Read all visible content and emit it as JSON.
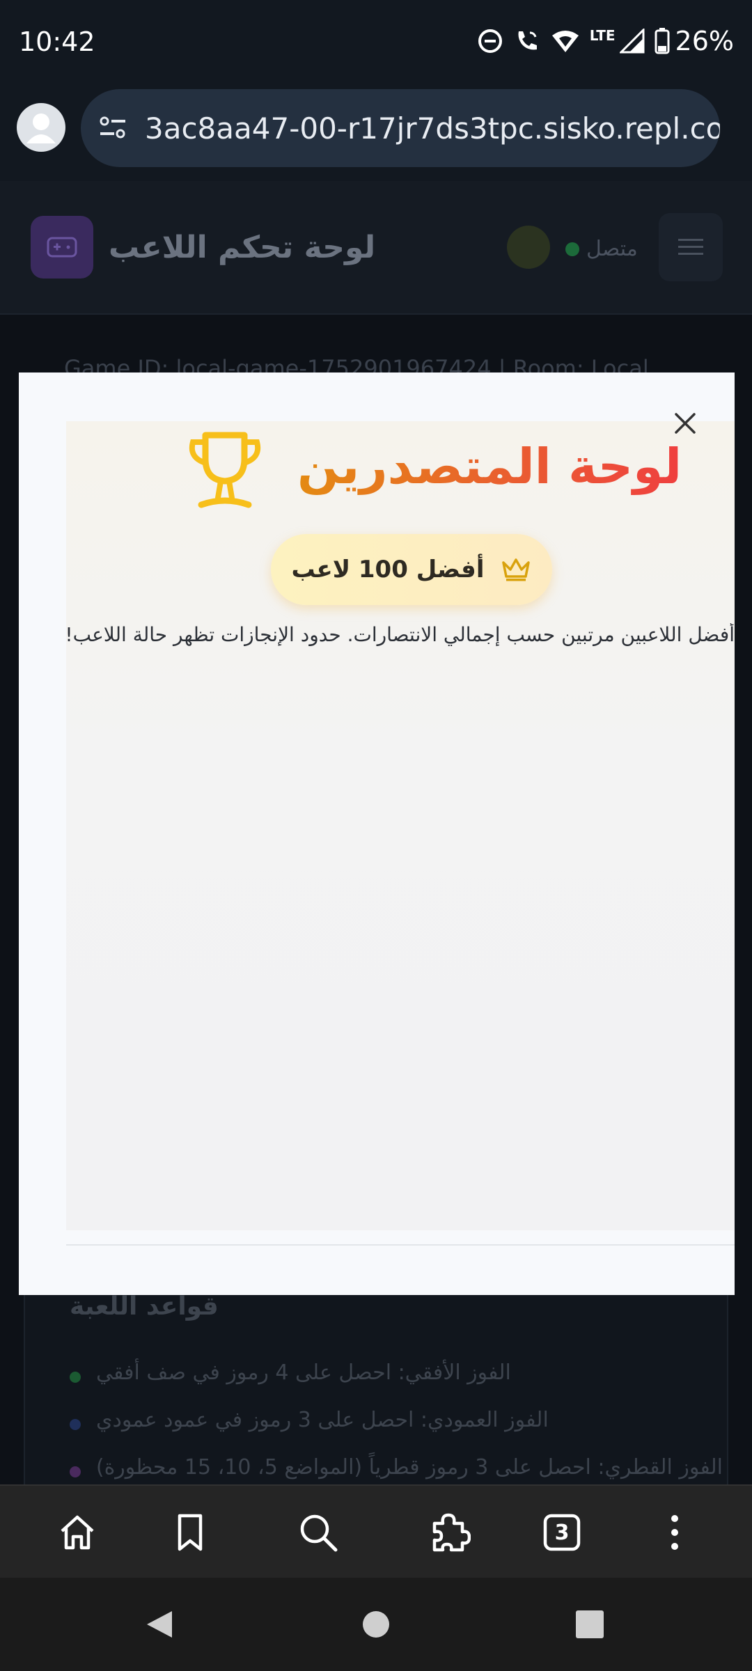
{
  "status_bar": {
    "time": "10:42",
    "network": "LTE",
    "battery": "26%"
  },
  "browser": {
    "url": "3ac8aa47-00-r17jr7ds3tpc.sisko.repl.co",
    "tab_count": "3"
  },
  "background_page": {
    "title": "لوحة تحكم اللاعب",
    "status": "متصل",
    "game_info": "Game ID: local-game-1752901967424 | Room: Local",
    "rules_title": "قواعد اللعبة",
    "rules": [
      "الفوز الأفقي: احصل على 4 رموز في صف أفقي",
      "الفوز العمودي: احصل على 3 رموز في عمود عمودي",
      "الفوز القطري: احصل على 3 رموز قطرياً (المواضع 5، 10، 15 محظورة)"
    ]
  },
  "leaderboard": {
    "title": "لوحة المتصدرين",
    "badge": "أفضل 100 لاعب",
    "description": "أفضل اللاعبين مرتبين حسب إجمالي الانتصارات. حدود الإنجازات تظهر حالة اللاعب!"
  },
  "colors": {
    "title_gradient_start": "#e48a12",
    "title_gradient_end": "#ef3f3f",
    "trophy": "#f7bf1a",
    "badge_bg": "#fdf2c0",
    "status_online": "#1c6b3a"
  }
}
